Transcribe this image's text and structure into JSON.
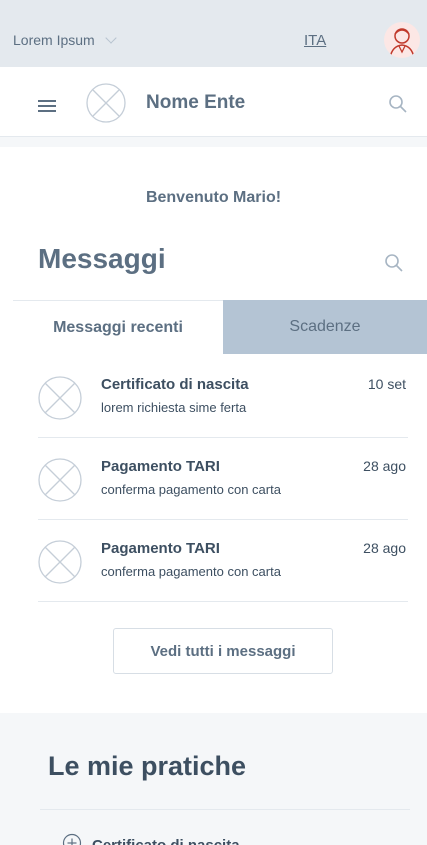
{
  "topbar": {
    "organization": "Lorem Ipsum",
    "language": "ITA"
  },
  "header": {
    "entity_name": "Nome Ente"
  },
  "welcome": "Benvenuto Mario!",
  "messages_section": {
    "title": "Messaggi",
    "tabs": [
      {
        "label": "Messaggi recenti",
        "active": true
      },
      {
        "label": "Scadenze",
        "active": false
      }
    ],
    "items": [
      {
        "subject": "Certificato di nascita",
        "snippet": "lorem richiesta sime ferta",
        "date": "10 set"
      },
      {
        "subject": "Pagamento TARI",
        "snippet": "conferma pagamento con carta",
        "date": "28 ago"
      },
      {
        "subject": "Pagamento TARI",
        "snippet": "conferma pagamento con carta",
        "date": "28 ago"
      }
    ],
    "see_all_label": "Vedi tutti i messaggi"
  },
  "practices": {
    "title": "Le mie pratiche",
    "items": [
      {
        "label": "Certificato di nascita"
      }
    ]
  },
  "colors": {
    "topbar_bg": "#e4e9ee",
    "text": "#5c6f82",
    "text_dark": "#3d4f61",
    "inactive_tab": "#b4c4d4",
    "section_bg": "#f5f7f9",
    "avatar_bg": "#fce7e5",
    "avatar_line": "#c0392b"
  },
  "icons": {
    "org_dropdown": "chevron-down-icon",
    "user": "user-avatar-icon",
    "menu": "hamburger-menu-icon",
    "logo": "placeholder-image-icon",
    "search": "search-icon",
    "expand": "plus-circle-icon"
  }
}
